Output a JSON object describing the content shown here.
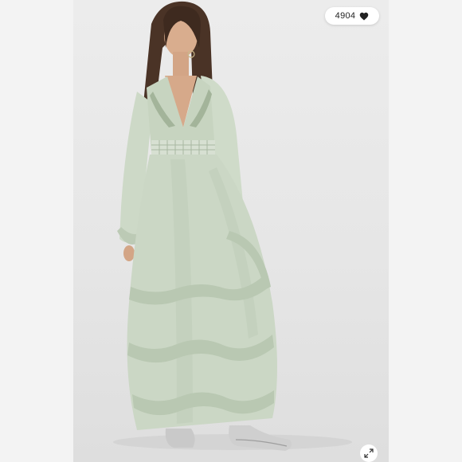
{
  "likes": {
    "count": "4904",
    "icon": "heart-icon"
  },
  "expand": {
    "icon": "expand-icon"
  },
  "colors": {
    "dress": "#c9d6c3",
    "background": "#e8e8e8"
  }
}
